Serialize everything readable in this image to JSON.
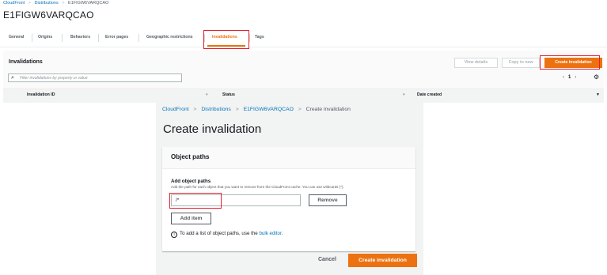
{
  "bg": {
    "breadcrumb": [
      "CloudFront",
      "Distributions",
      "E1FIGW6VARQCAO"
    ],
    "breadcrumb_sep": ">",
    "distribution_title": "E1FIGW6VARQCAO",
    "tabs": [
      "General",
      "Origins",
      "Behaviors",
      "Error pages",
      "Geographic restrictions",
      "Invalidations",
      "Tags"
    ],
    "active_tab": "Invalidations",
    "invalidations": {
      "title": "Invalidations",
      "filter_placeholder": "Filter invalidations by property or value",
      "buttons": {
        "view_details": "View details",
        "copy_to_new": "Copy to new",
        "create": "Create invalidation"
      },
      "page_number": "1",
      "columns": [
        "Invalidation ID",
        "Status",
        "Date created"
      ]
    }
  },
  "create": {
    "breadcrumb": [
      "CloudFront",
      "Distributions",
      "E1FIGW6VARQCAO",
      "Create invalidation"
    ],
    "title": "Create invalidation",
    "card_title": "Object paths",
    "add_label": "Add object paths",
    "add_description": "Add the path for each object that you want to remove from the CloudFront cache. You can use wildcards (*).",
    "path_value": "/*",
    "remove_label": "Remove",
    "add_item_label": "Add item",
    "info_prefix": "To add a list of object paths, use the",
    "info_link": "bulk editor",
    "info_suffix": ".",
    "cancel_label": "Cancel",
    "submit_label": "Create invalidation"
  },
  "colors": {
    "accent": "#ec7211",
    "link": "#0073bb",
    "highlight": "#e3202e"
  }
}
